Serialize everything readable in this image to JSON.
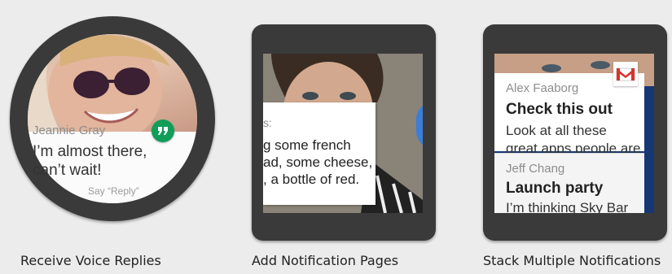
{
  "colors": {
    "hangouts": "#0f9d58",
    "gmail_red": "#d8332b",
    "bezel": "#3a3a3a"
  },
  "features": [
    {
      "caption": "Receive Voice Replies",
      "watch_shape": "round",
      "notification": {
        "sender": "Jeannie Gray",
        "message": "I’m almost there, can’t wait!",
        "hint": "Say “Reply”",
        "app_icon": "hangouts-icon"
      }
    },
    {
      "caption": "Add Notification Pages",
      "watch_shape": "square",
      "notification": {
        "label_fragment": "s:",
        "body_fragment": "g some french\nad, some cheese,\n, a bottle of red.",
        "pages": 2,
        "current_page": 1
      }
    },
    {
      "caption": "Stack Multiple Notifications",
      "watch_shape": "square",
      "stack": [
        {
          "sender": "Alex Faaborg",
          "title": "Check this out",
          "text": "Look at all these",
          "text2": "great apps people are",
          "app_icon": "gmail-icon"
        },
        {
          "sender": "Jeff Chang",
          "title": "Launch party",
          "text": "I’m thinking Sky Bar"
        }
      ]
    }
  ]
}
